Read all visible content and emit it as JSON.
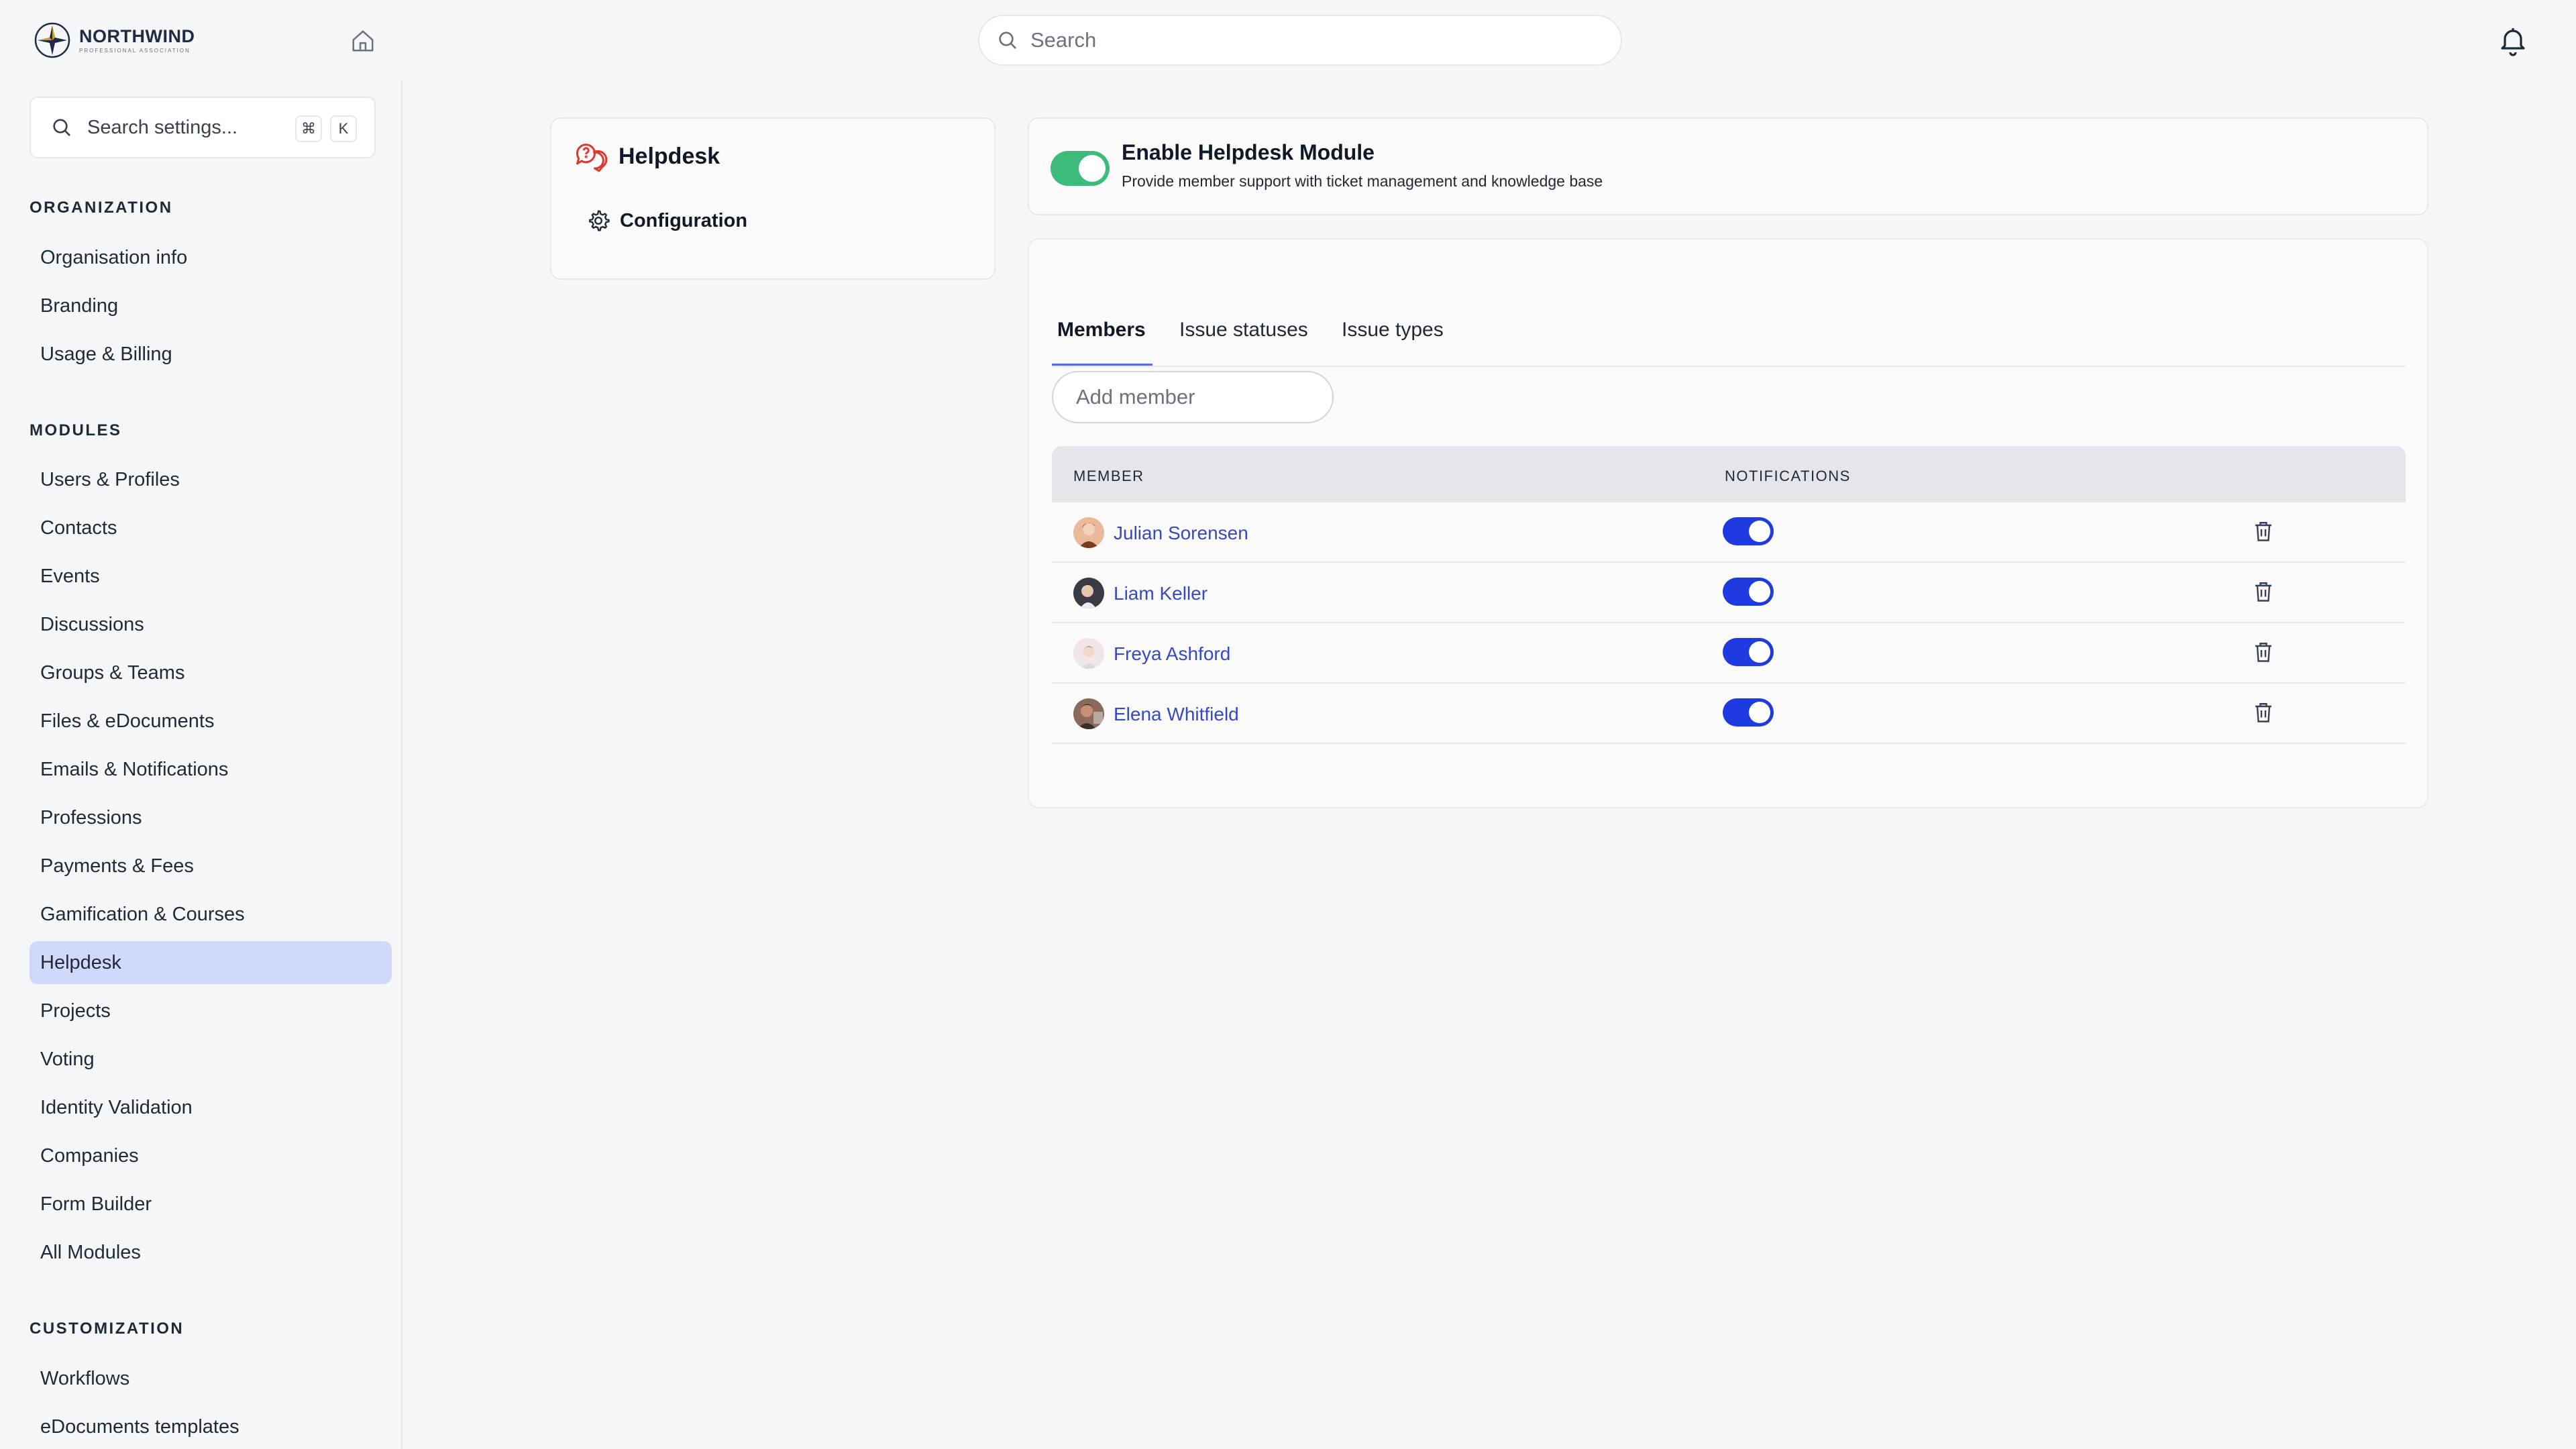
{
  "header": {
    "logo_name": "NORTHWIND",
    "logo_sub": "PROFESSIONAL ASSOCIATION",
    "search_placeholder": "Search"
  },
  "sidebar": {
    "search_placeholder": "Search settings...",
    "shortcut_mod": "⌘",
    "shortcut_key": "K",
    "sections": [
      {
        "title": "ORGANIZATION",
        "items": [
          "Organisation info",
          "Branding",
          "Usage & Billing"
        ]
      },
      {
        "title": "MODULES",
        "items": [
          "Users & Profiles",
          "Contacts",
          "Events",
          "Discussions",
          "Groups & Teams",
          "Files & eDocuments",
          "Emails & Notifications",
          "Professions",
          "Payments & Fees",
          "Gamification & Courses",
          "Helpdesk",
          "Projects",
          "Voting",
          "Identity Validation",
          "Companies",
          "Form Builder",
          "All Modules"
        ]
      },
      {
        "title": "CUSTOMIZATION",
        "items": [
          "Workflows",
          "eDocuments templates"
        ]
      }
    ],
    "active_item": "Helpdesk"
  },
  "module_card": {
    "title": "Helpdesk",
    "link": "Configuration"
  },
  "enable": {
    "title": "Enable Helpdesk Module",
    "description": "Provide member support with ticket management and knowledge base",
    "enabled": true
  },
  "members": {
    "tabs": [
      "Members",
      "Issue statuses",
      "Issue types"
    ],
    "active_tab": "Members",
    "add_placeholder": "Add member",
    "columns": {
      "member": "MEMBER",
      "notifications": "NOTIFICATIONS"
    },
    "rows": [
      {
        "name": "Julian Sorensen",
        "notifications": true
      },
      {
        "name": "Liam Keller",
        "notifications": true
      },
      {
        "name": "Freya Ashford",
        "notifications": true
      },
      {
        "name": "Elena Whitfield",
        "notifications": true
      }
    ]
  },
  "colors": {
    "accent": "#1d3be0",
    "active_nav": "#d1d9fb",
    "enable_toggle": "#3dbb7a",
    "link": "#3549c6"
  }
}
